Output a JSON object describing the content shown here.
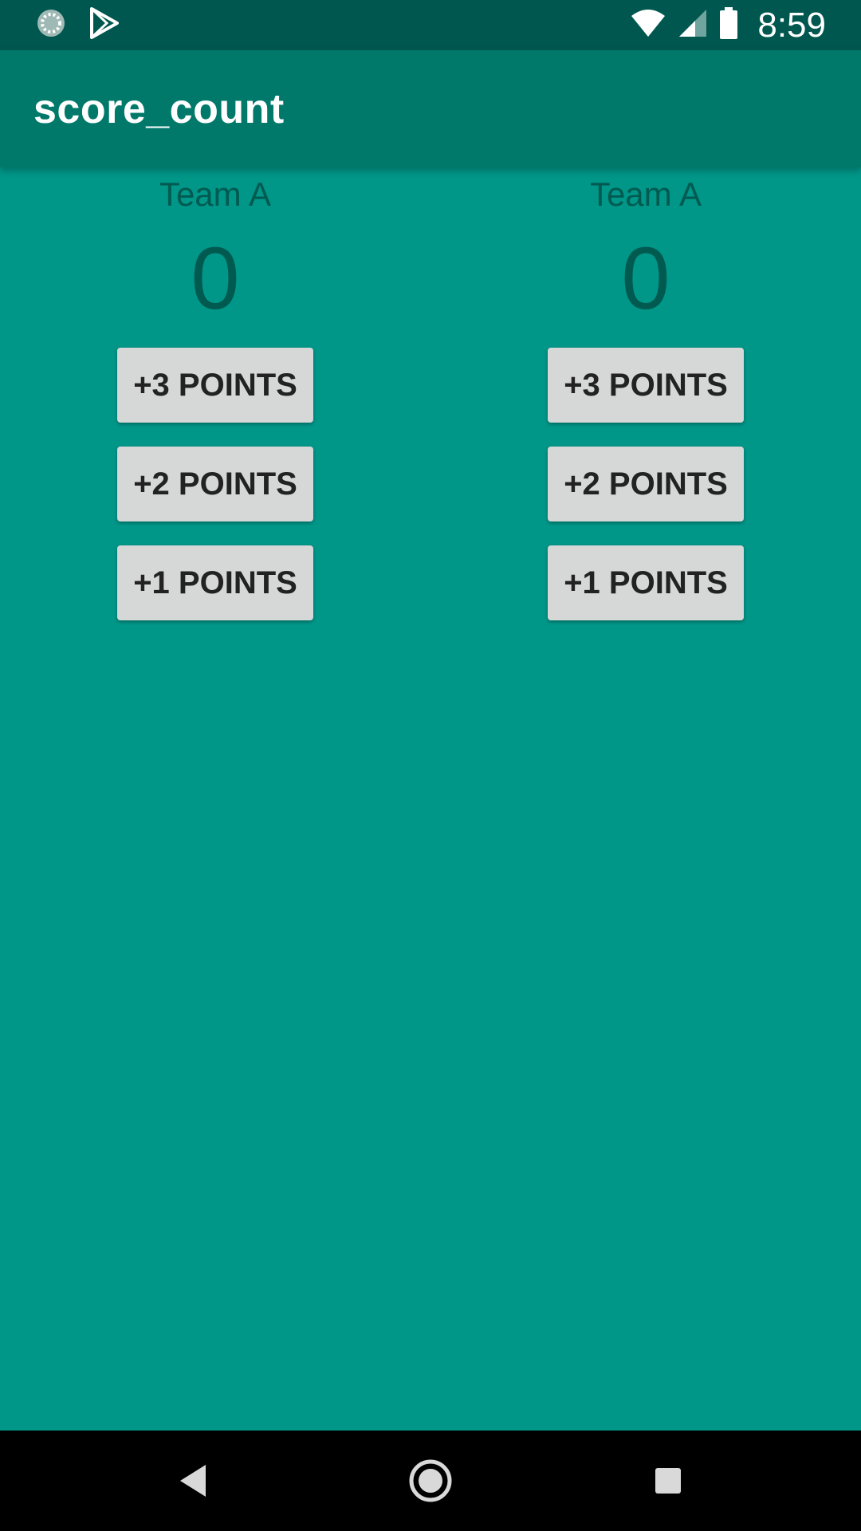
{
  "status_bar": {
    "time": "8:59",
    "left_icons": [
      "loading-icon",
      "play-store-icon"
    ],
    "right_icons": [
      "wifi-icon",
      "signal-icon",
      "battery-icon"
    ]
  },
  "app_bar": {
    "title": "score_count"
  },
  "teams": [
    {
      "name": "Team A",
      "score": "0",
      "buttons": [
        "+3 POINTS",
        "+2 POINTS",
        "+1 POINTS"
      ]
    },
    {
      "name": "Team A",
      "score": "0",
      "buttons": [
        "+3 POINTS",
        "+2 POINTS",
        "+1 POINTS"
      ]
    }
  ],
  "nav_bar": {
    "icons": [
      "back-icon",
      "home-icon",
      "recents-icon"
    ]
  },
  "colors": {
    "status_bar": "#00574f",
    "app_bar": "#00796b",
    "background": "#009688",
    "button": "#d6d7d7",
    "team_text": "#005a50"
  }
}
